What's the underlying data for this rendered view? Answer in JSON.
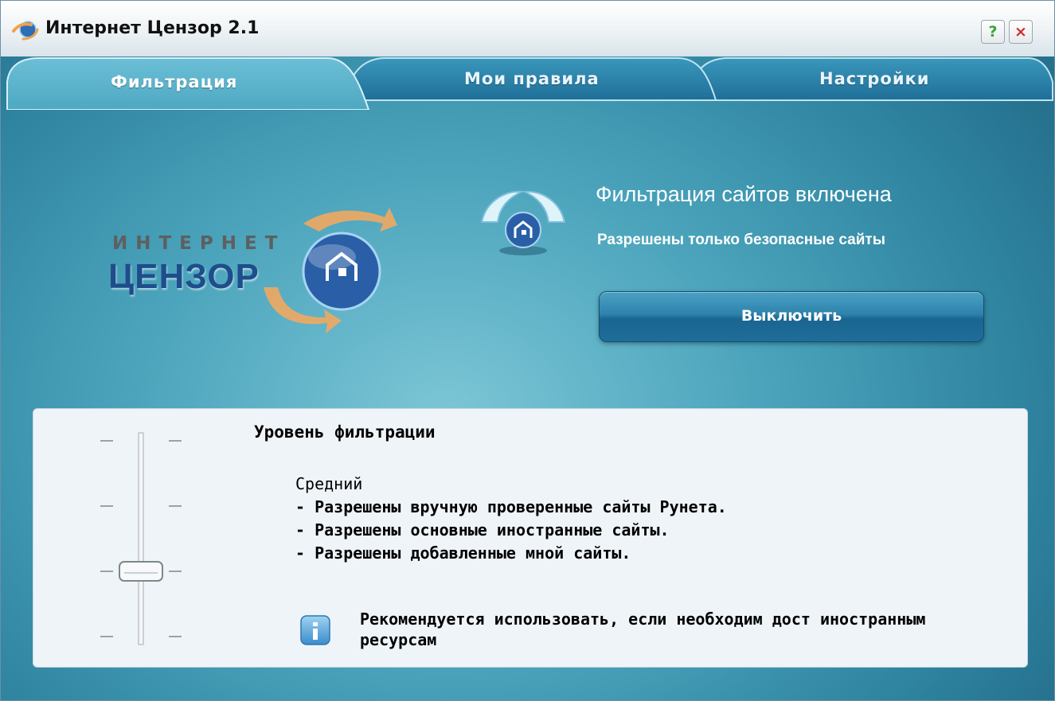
{
  "window": {
    "title": "Интернет Цензор 2.1"
  },
  "titlebar": {
    "help_label": "?",
    "close_label": "×"
  },
  "tabs": [
    {
      "label": "Фильтрация"
    },
    {
      "label": "Мои правила"
    },
    {
      "label": "Настройки"
    }
  ],
  "logo": {
    "line1": "ИНТЕРНЕТ",
    "line2": "ЦЕНЗОР"
  },
  "status": {
    "title": "Фильтрация сайтов включена",
    "subtitle": "Разрешены только безопасные сайты",
    "button_label": "Выключить"
  },
  "filter_level": {
    "title": "Уровень фильтрации",
    "level_name": "Средний",
    "slider_positions": 4,
    "selected_index_from_top": 2,
    "details": [
      "- Разрешены вручную проверенные сайты Рунета.",
      "- Разрешены основные иностранные сайты.",
      "- Разрешены добавленные мной сайты."
    ],
    "recommendation": "Рекомендуется использовать, если необходим дост иностранным ресурсам"
  },
  "colors": {
    "accent_blue": "#2f84a0",
    "button_blue": "#1f6d99",
    "panel_bg": "#eef4f8"
  }
}
